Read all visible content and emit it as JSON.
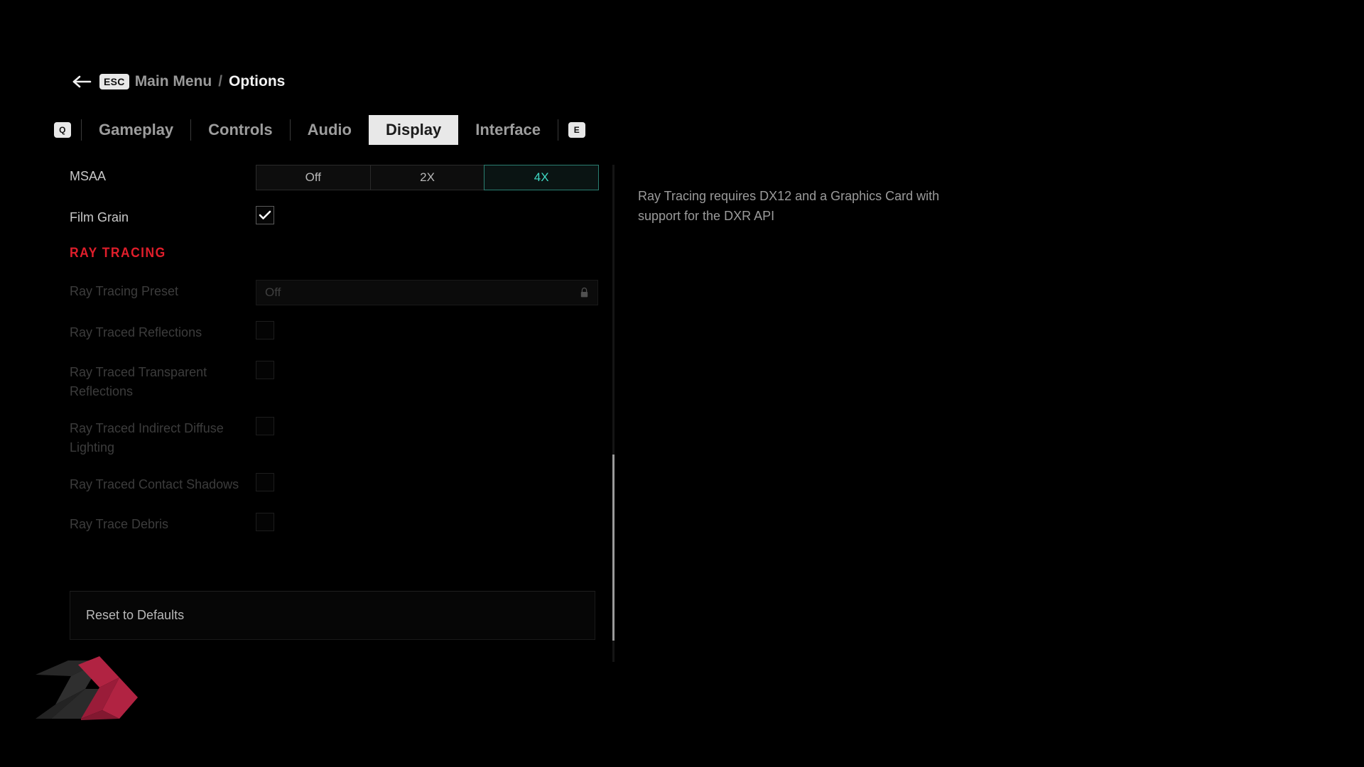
{
  "breadcrumb": {
    "back_icon": "arrow-left-icon",
    "esc_key": "ESC",
    "parent": "Main Menu",
    "separator": "/",
    "current": "Options"
  },
  "tabs": {
    "prev_key": "Q",
    "next_key": "E",
    "items": [
      {
        "label": "Gameplay",
        "active": false
      },
      {
        "label": "Controls",
        "active": false
      },
      {
        "label": "Audio",
        "active": false
      },
      {
        "label": "Display",
        "active": true
      },
      {
        "label": "Interface",
        "active": false
      }
    ]
  },
  "settings": {
    "msaa": {
      "label": "MSAA",
      "options": [
        "Off",
        "2X",
        "4X"
      ],
      "selected": "4X"
    },
    "film_grain": {
      "label": "Film Grain",
      "checked": true
    },
    "section_ray_tracing": "RAY TRACING",
    "ray_tracing_preset": {
      "label": "Ray Tracing Preset",
      "value": "Off",
      "locked": true,
      "lock_icon": "lock-icon"
    },
    "ray_tracing_toggles": [
      {
        "label": "Ray Traced Reflections",
        "checked": false,
        "disabled": true
      },
      {
        "label": "Ray Traced Transparent Reflections",
        "checked": false,
        "disabled": true
      },
      {
        "label": "Ray Traced Indirect Diffuse Lighting",
        "checked": false,
        "disabled": true
      },
      {
        "label": "Ray Traced Contact Shadows",
        "checked": false,
        "disabled": true
      },
      {
        "label": "Ray Trace Debris",
        "checked": false,
        "disabled": true
      }
    ],
    "reset_to_defaults": "Reset to Defaults"
  },
  "help": {
    "text": "Ray Tracing requires DX12 and a Graphics Card with support for the DXR API"
  },
  "colors": {
    "background": "#000000",
    "accent_selected": "#3fd9c4",
    "section_red": "#e01e2b",
    "tab_active_bg": "#e8e8e8",
    "text_primary": "#c9c9c9",
    "text_disabled": "#3c3c3c",
    "watermark_red": "#c02648",
    "watermark_gray": "#3b3b3b"
  }
}
